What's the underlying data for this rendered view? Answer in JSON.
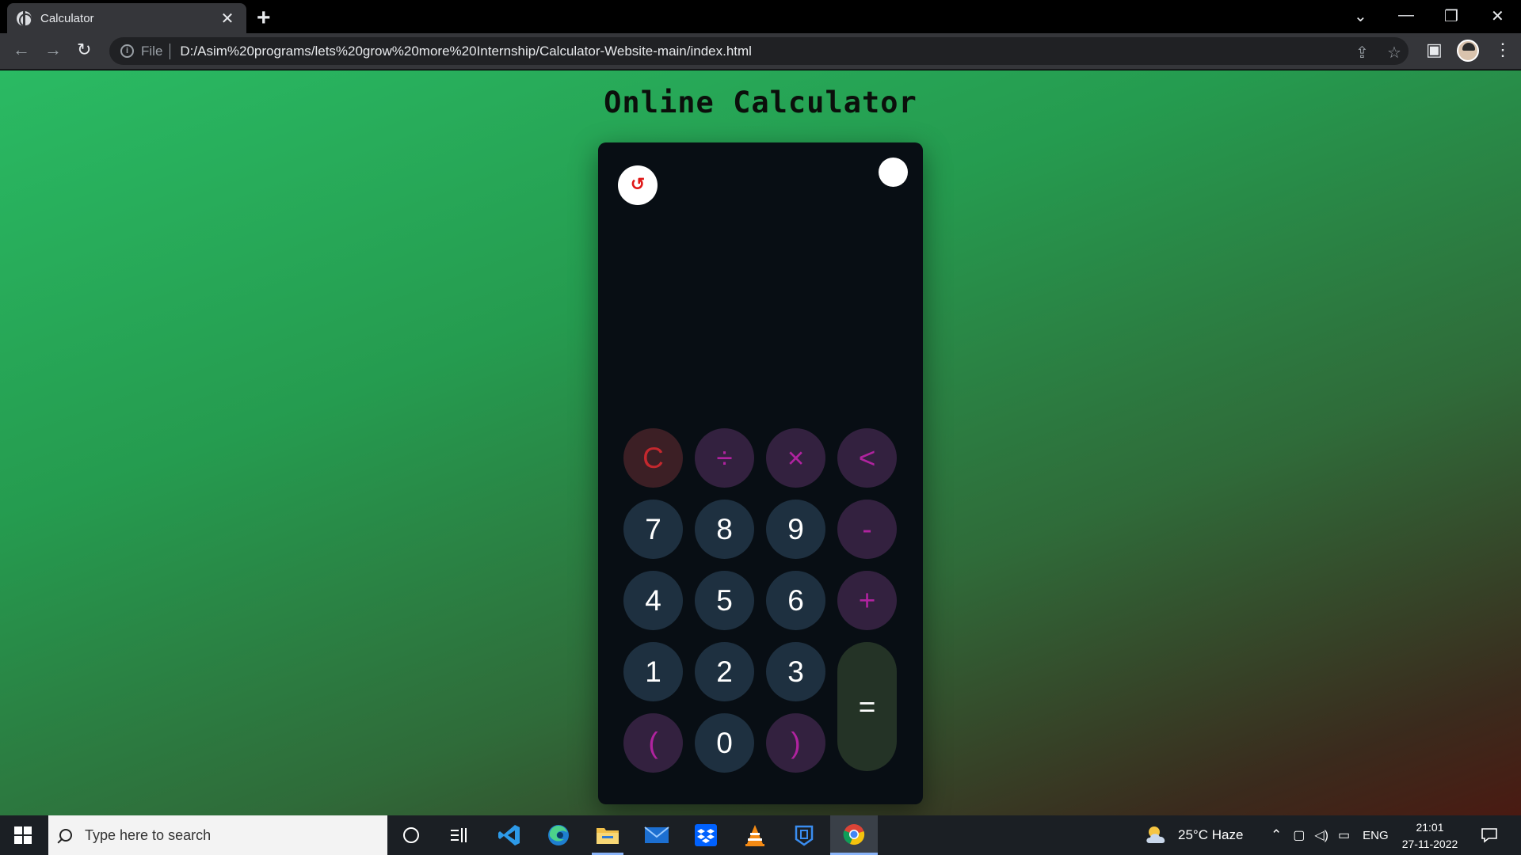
{
  "browser": {
    "tab_title": "Calculator",
    "tab_close": "✕",
    "new_tab": "+",
    "window_controls": {
      "tab_search": "⌄",
      "minimize": "—",
      "restore": "❐",
      "close": "✕"
    },
    "nav": {
      "back": "←",
      "forward": "→",
      "reload": "↻"
    },
    "address": {
      "info_symbol": "i",
      "scheme_chip": "File",
      "url": "D:/Asim%20programs/lets%20grow%20more%20Internship/Calculator-Website-main/index.html"
    },
    "toolbar_icons": {
      "share": "⇪",
      "bookmark": "☆",
      "side_panel": "▣",
      "menu": "⋮"
    }
  },
  "page": {
    "title": "Online Calculator",
    "display_value": "",
    "history_icon": "↺",
    "colors": {
      "calc_body": "#080e14",
      "number_key": "#1e3040",
      "operator_key": "#33213f",
      "operator_text": "#b0239f",
      "clear_key": "#3c1f25",
      "clear_text": "#c4282e",
      "equals_key": "#243326"
    },
    "keys": [
      {
        "label": "C",
        "kind": "clear"
      },
      {
        "label": "÷",
        "kind": "op"
      },
      {
        "label": "×",
        "kind": "op"
      },
      {
        "label": "<",
        "kind": "op"
      },
      {
        "label": "7",
        "kind": "num"
      },
      {
        "label": "8",
        "kind": "num"
      },
      {
        "label": "9",
        "kind": "num"
      },
      {
        "label": "-",
        "kind": "op"
      },
      {
        "label": "4",
        "kind": "num"
      },
      {
        "label": "5",
        "kind": "num"
      },
      {
        "label": "6",
        "kind": "num"
      },
      {
        "label": "+",
        "kind": "op"
      },
      {
        "label": "1",
        "kind": "num"
      },
      {
        "label": "2",
        "kind": "num"
      },
      {
        "label": "3",
        "kind": "num"
      },
      {
        "label": "=",
        "kind": "equals"
      },
      {
        "label": "(",
        "kind": "op"
      },
      {
        "label": "0",
        "kind": "num"
      },
      {
        "label": ")",
        "kind": "op"
      }
    ]
  },
  "taskbar": {
    "search_placeholder": "Type here to search",
    "apps": [
      "cortana-icon",
      "task-view-icon",
      "vscode-icon",
      "edge-icon",
      "file-explorer-icon",
      "mail-icon",
      "dropbox-icon",
      "vlc-icon",
      "app-icon",
      "chrome-icon"
    ],
    "weather": "25°C  Haze",
    "language": "ENG",
    "time": "21:01",
    "date": "27-11-2022"
  }
}
